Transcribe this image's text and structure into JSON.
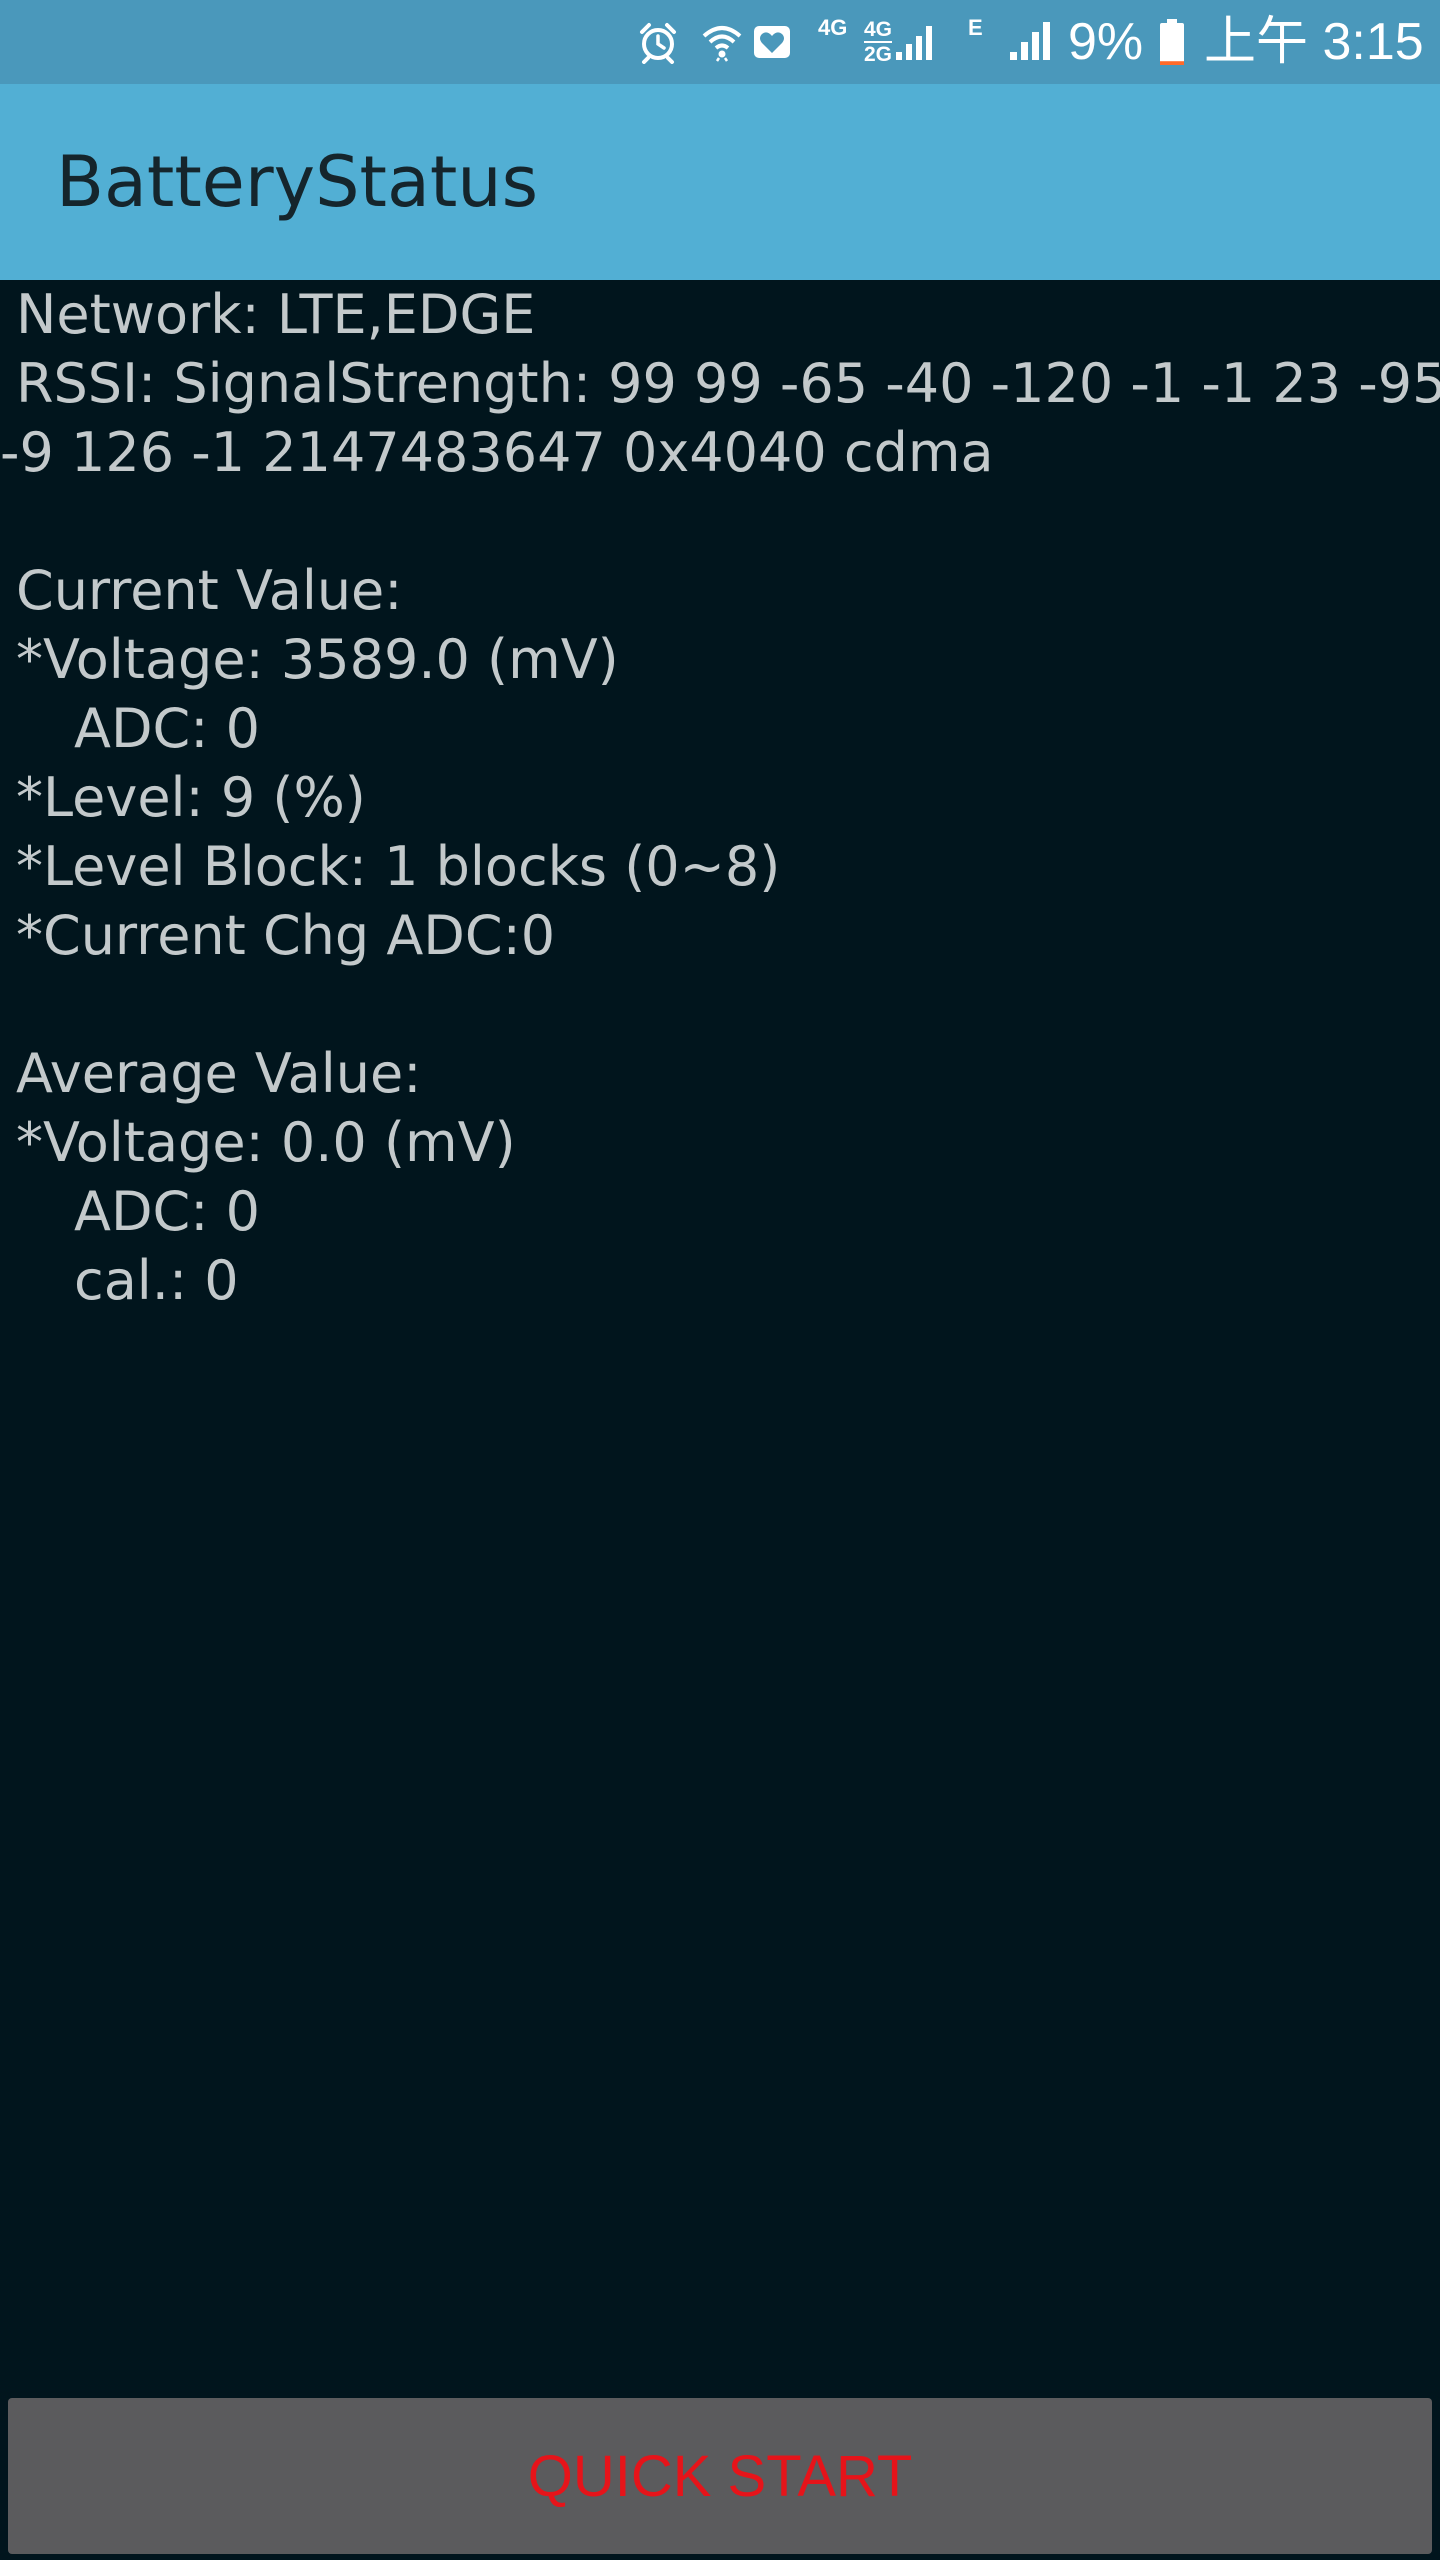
{
  "status_bar": {
    "network_4g_label": "4G",
    "network_4g_2g_top": "4G",
    "network_4g_2g_bottom": "2G",
    "network_e_label": "E",
    "battery_percent": "9%",
    "battery_level": 0.09,
    "time": "上午 3:15",
    "icons": [
      "alarm-icon",
      "wifi-icon",
      "health-icon",
      "signal-icon",
      "battery-icon"
    ],
    "colors": {
      "background": "#4a98bb",
      "battery_low": "#ff6a2a"
    }
  },
  "app_bar": {
    "title": "BatteryStatus",
    "colors": {
      "background": "#52afd4",
      "title": "#15252c"
    }
  },
  "content": {
    "network": "Network: LTE,EDGE",
    "rssi_line1": "RSSI: SignalStrength: 99 99 -65 -40 -120 -1 -1 23 -95",
    "rssi_line2": "-9 126 -1 2147483647 0x4040 cdma",
    "current_header": "Current Value:",
    "current_voltage": "*Voltage:  3589.0 (mV)",
    "current_adc": "ADC:  0",
    "current_level": "*Level: 9 (%)",
    "current_level_block": "*Level Block: 1 blocks (0~8)",
    "current_chg_adc": "*Current Chg ADC:0",
    "average_header": "Average Value:",
    "average_voltage": "*Voltage:  0.0 (mV)",
    "average_adc": "ADC:  0",
    "average_cal": "cal.: 0",
    "colors": {
      "background": "#01151d",
      "text": "#c3c9cb"
    }
  },
  "quick_start": {
    "label": "QUICK START",
    "colors": {
      "background": "#5b5b5d",
      "text": "#e6141a"
    }
  }
}
